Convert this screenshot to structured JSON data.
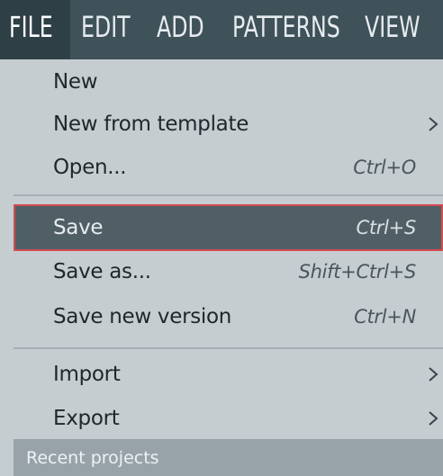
{
  "menubar": {
    "items": [
      {
        "label": "FILE",
        "active": true
      },
      {
        "label": "EDIT"
      },
      {
        "label": "ADD"
      },
      {
        "label": "PATTERNS"
      },
      {
        "label": "VIEW"
      }
    ]
  },
  "file_menu": {
    "items": [
      {
        "label": "New",
        "shortcut": ""
      },
      {
        "label": "New from template",
        "shortcut": "",
        "has_submenu": true
      },
      {
        "label": "Open...",
        "shortcut": "Ctrl+O"
      },
      {
        "label": "Save",
        "shortcut": "Ctrl+S",
        "highlighted": true
      },
      {
        "label": "Save as...",
        "shortcut": "Shift+Ctrl+S"
      },
      {
        "label": "Save new version",
        "shortcut": "Ctrl+N"
      },
      {
        "label": "Import",
        "shortcut": "",
        "has_submenu": true
      },
      {
        "label": "Export",
        "shortcut": "",
        "has_submenu": true
      }
    ],
    "section_header": "Recent projects"
  },
  "colors": {
    "menubar_bg": "#3f5159",
    "menu_bg": "#c6cdd1",
    "highlight_bg": "#505f66",
    "highlight_border": "#d64a52",
    "section_header_bg": "#98a3a9"
  }
}
